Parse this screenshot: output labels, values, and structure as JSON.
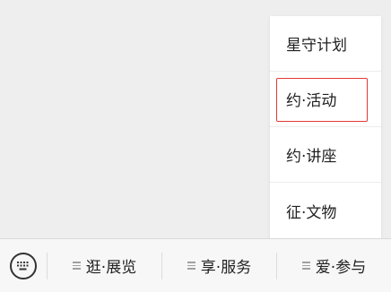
{
  "popup": {
    "items": [
      {
        "label": "星守计划",
        "highlighted": false
      },
      {
        "label": "约·活动",
        "highlighted": true
      },
      {
        "label": "约·讲座",
        "highlighted": false
      },
      {
        "label": "征·文物",
        "highlighted": false
      }
    ]
  },
  "menubar": {
    "keyboard_icon": "keyboard-icon",
    "menu_icon": "menu-lines-icon",
    "items": [
      {
        "label": "逛·展览"
      },
      {
        "label": "享·服务"
      },
      {
        "label": "爱·参与"
      }
    ]
  },
  "colors": {
    "background": "#eeeeee",
    "highlight_border": "#e53935",
    "menubar_bg": "#f7f7f7"
  }
}
